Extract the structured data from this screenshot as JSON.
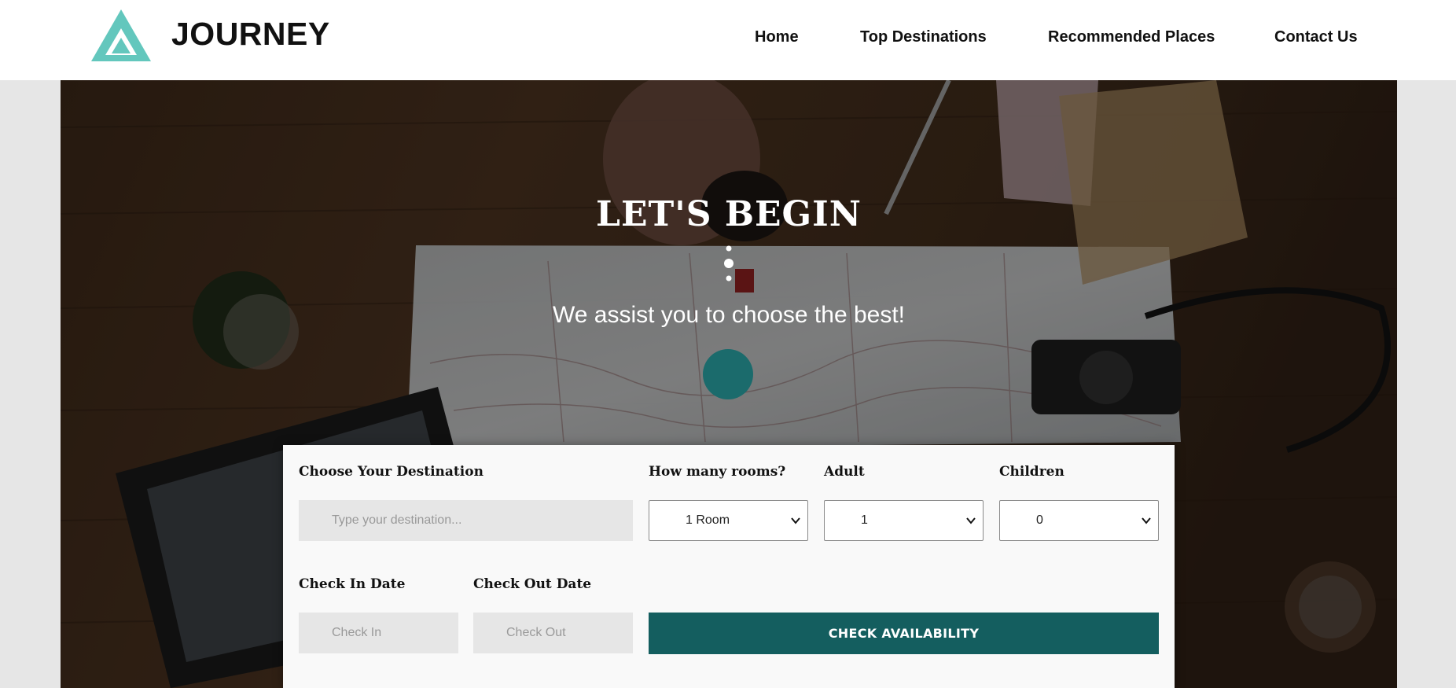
{
  "brand": {
    "name": "JOURNEY",
    "logo_icon": "triangle-logo-icon",
    "logo_color": "#63c7bd"
  },
  "nav": [
    "Home",
    "Top Destinations",
    "Recommended Places",
    "Contact Us"
  ],
  "hero": {
    "title": "LET'S BEGIN",
    "subtitle": "We assist you to choose the best!",
    "accent_color": "#1b6b6c"
  },
  "booking": {
    "destination": {
      "label": "Choose Your Destination",
      "placeholder": "Type your destination..."
    },
    "rooms": {
      "label": "How many rooms?",
      "value": "1 Room"
    },
    "adult": {
      "label": "Adult",
      "value": "1"
    },
    "children": {
      "label": "Children",
      "value": "0"
    },
    "check_in": {
      "label": "Check In Date",
      "placeholder": "Check In"
    },
    "check_out": {
      "label": "Check Out Date",
      "placeholder": "Check Out"
    },
    "submit_label": "CHECK AVAILABILITY",
    "button_color": "#145e5f"
  }
}
